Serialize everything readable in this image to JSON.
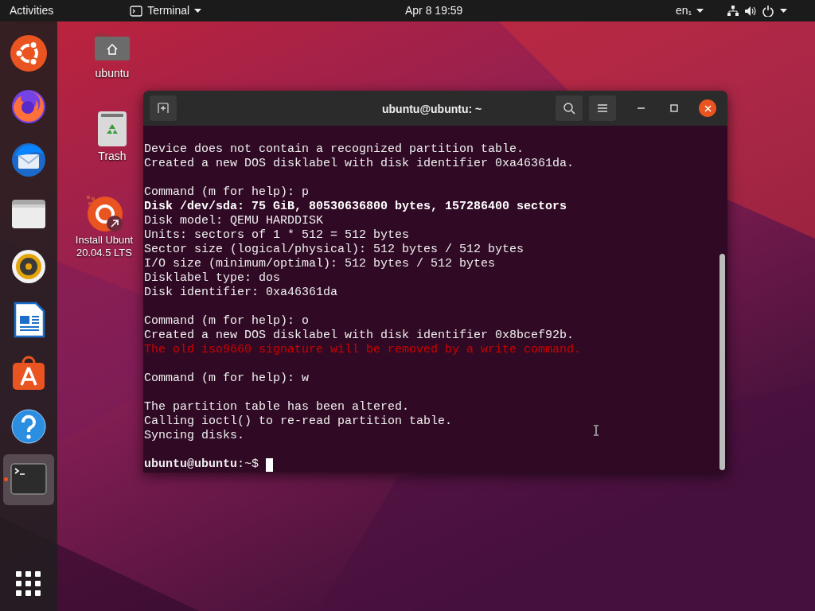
{
  "top_bar": {
    "activities": "Activities",
    "app_menu": "Terminal",
    "clock": "Apr 8  19:59",
    "input_source": "en₁"
  },
  "dock": {
    "items": [
      {
        "kind": "ubuntu",
        "running": false
      },
      {
        "kind": "firefox",
        "running": false
      },
      {
        "kind": "thunderbird",
        "running": false
      },
      {
        "kind": "files",
        "running": false
      },
      {
        "kind": "rhythmbox",
        "running": false
      },
      {
        "kind": "writer",
        "running": false
      },
      {
        "kind": "software",
        "running": false
      },
      {
        "kind": "help",
        "running": false
      },
      {
        "kind": "terminal",
        "running": true
      }
    ]
  },
  "desktop_icons": [
    {
      "kind": "home",
      "label": "ubuntu"
    },
    {
      "kind": "trash",
      "label": "Trash"
    },
    {
      "kind": "installer",
      "label": "Install Ubunt\n20.04.5 LTS"
    }
  ],
  "terminal": {
    "title": "ubuntu@ubuntu: ~",
    "lines": [
      {
        "kind": "blank"
      },
      {
        "kind": "normal",
        "text": "Device does not contain a recognized partition table."
      },
      {
        "kind": "normal",
        "text": "Created a new DOS disklabel with disk identifier 0xa46361da."
      },
      {
        "kind": "blank"
      },
      {
        "kind": "normal",
        "text": "Command (m for help): p"
      },
      {
        "kind": "bold",
        "text": "Disk /dev/sda: 75 GiB, 80530636800 bytes, 157286400 sectors"
      },
      {
        "kind": "normal",
        "text": "Disk model: QEMU HARDDISK"
      },
      {
        "kind": "normal",
        "text": "Units: sectors of 1 * 512 = 512 bytes"
      },
      {
        "kind": "normal",
        "text": "Sector size (logical/physical): 512 bytes / 512 bytes"
      },
      {
        "kind": "normal",
        "text": "I/O size (minimum/optimal): 512 bytes / 512 bytes"
      },
      {
        "kind": "normal",
        "text": "Disklabel type: dos"
      },
      {
        "kind": "normal",
        "text": "Disk identifier: 0xa46361da"
      },
      {
        "kind": "blank"
      },
      {
        "kind": "normal",
        "text": "Command (m for help): o"
      },
      {
        "kind": "normal",
        "text": "Created a new DOS disklabel with disk identifier 0x8bcef92b."
      },
      {
        "kind": "error",
        "text": "The old iso9660 signature will be removed by a write command."
      },
      {
        "kind": "blank"
      },
      {
        "kind": "normal",
        "text": "Command (m for help): w"
      },
      {
        "kind": "blank"
      },
      {
        "kind": "normal",
        "text": "The partition table has been altered."
      },
      {
        "kind": "normal",
        "text": "Calling ioctl() to re-read partition table."
      },
      {
        "kind": "normal",
        "text": "Syncing disks."
      },
      {
        "kind": "blank"
      },
      {
        "kind": "prompt",
        "text": "**ubuntu@ubuntu**:*~*$ "
      }
    ]
  }
}
